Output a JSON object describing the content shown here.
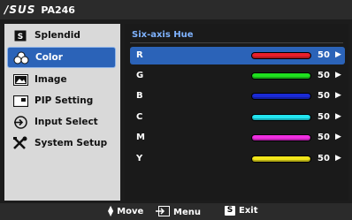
{
  "titlebar": {
    "brand": "/SUS",
    "model": "PA246"
  },
  "sidebar": {
    "items": [
      {
        "label": "Splendid",
        "icon": "splendid-s-icon"
      },
      {
        "label": "Color",
        "icon": "color-drops-icon",
        "active": true
      },
      {
        "label": "Image",
        "icon": "image-icon"
      },
      {
        "label": "PIP Setting",
        "icon": "pip-icon"
      },
      {
        "label": "Input Select",
        "icon": "input-select-icon"
      },
      {
        "label": "System Setup",
        "icon": "tools-icon"
      }
    ]
  },
  "panel": {
    "title": "Six-axis Hue",
    "rows": [
      {
        "name": "R",
        "value": "50",
        "color": "#e8202a",
        "active": true
      },
      {
        "name": "G",
        "value": "50",
        "color": "#1fe01f"
      },
      {
        "name": "B",
        "value": "50",
        "color": "#1a2ad6"
      },
      {
        "name": "C",
        "value": "50",
        "color": "#22e5f0"
      },
      {
        "name": "M",
        "value": "50",
        "color": "#ef2ee0"
      },
      {
        "name": "Y",
        "value": "50",
        "color": "#f2e61b"
      }
    ]
  },
  "footer": {
    "move_label": "Move",
    "menu_label": "Menu",
    "exit_key": "S",
    "exit_label": "Exit"
  },
  "colors": {
    "accent": "#2b63b8",
    "title": "#7fb3ff"
  }
}
